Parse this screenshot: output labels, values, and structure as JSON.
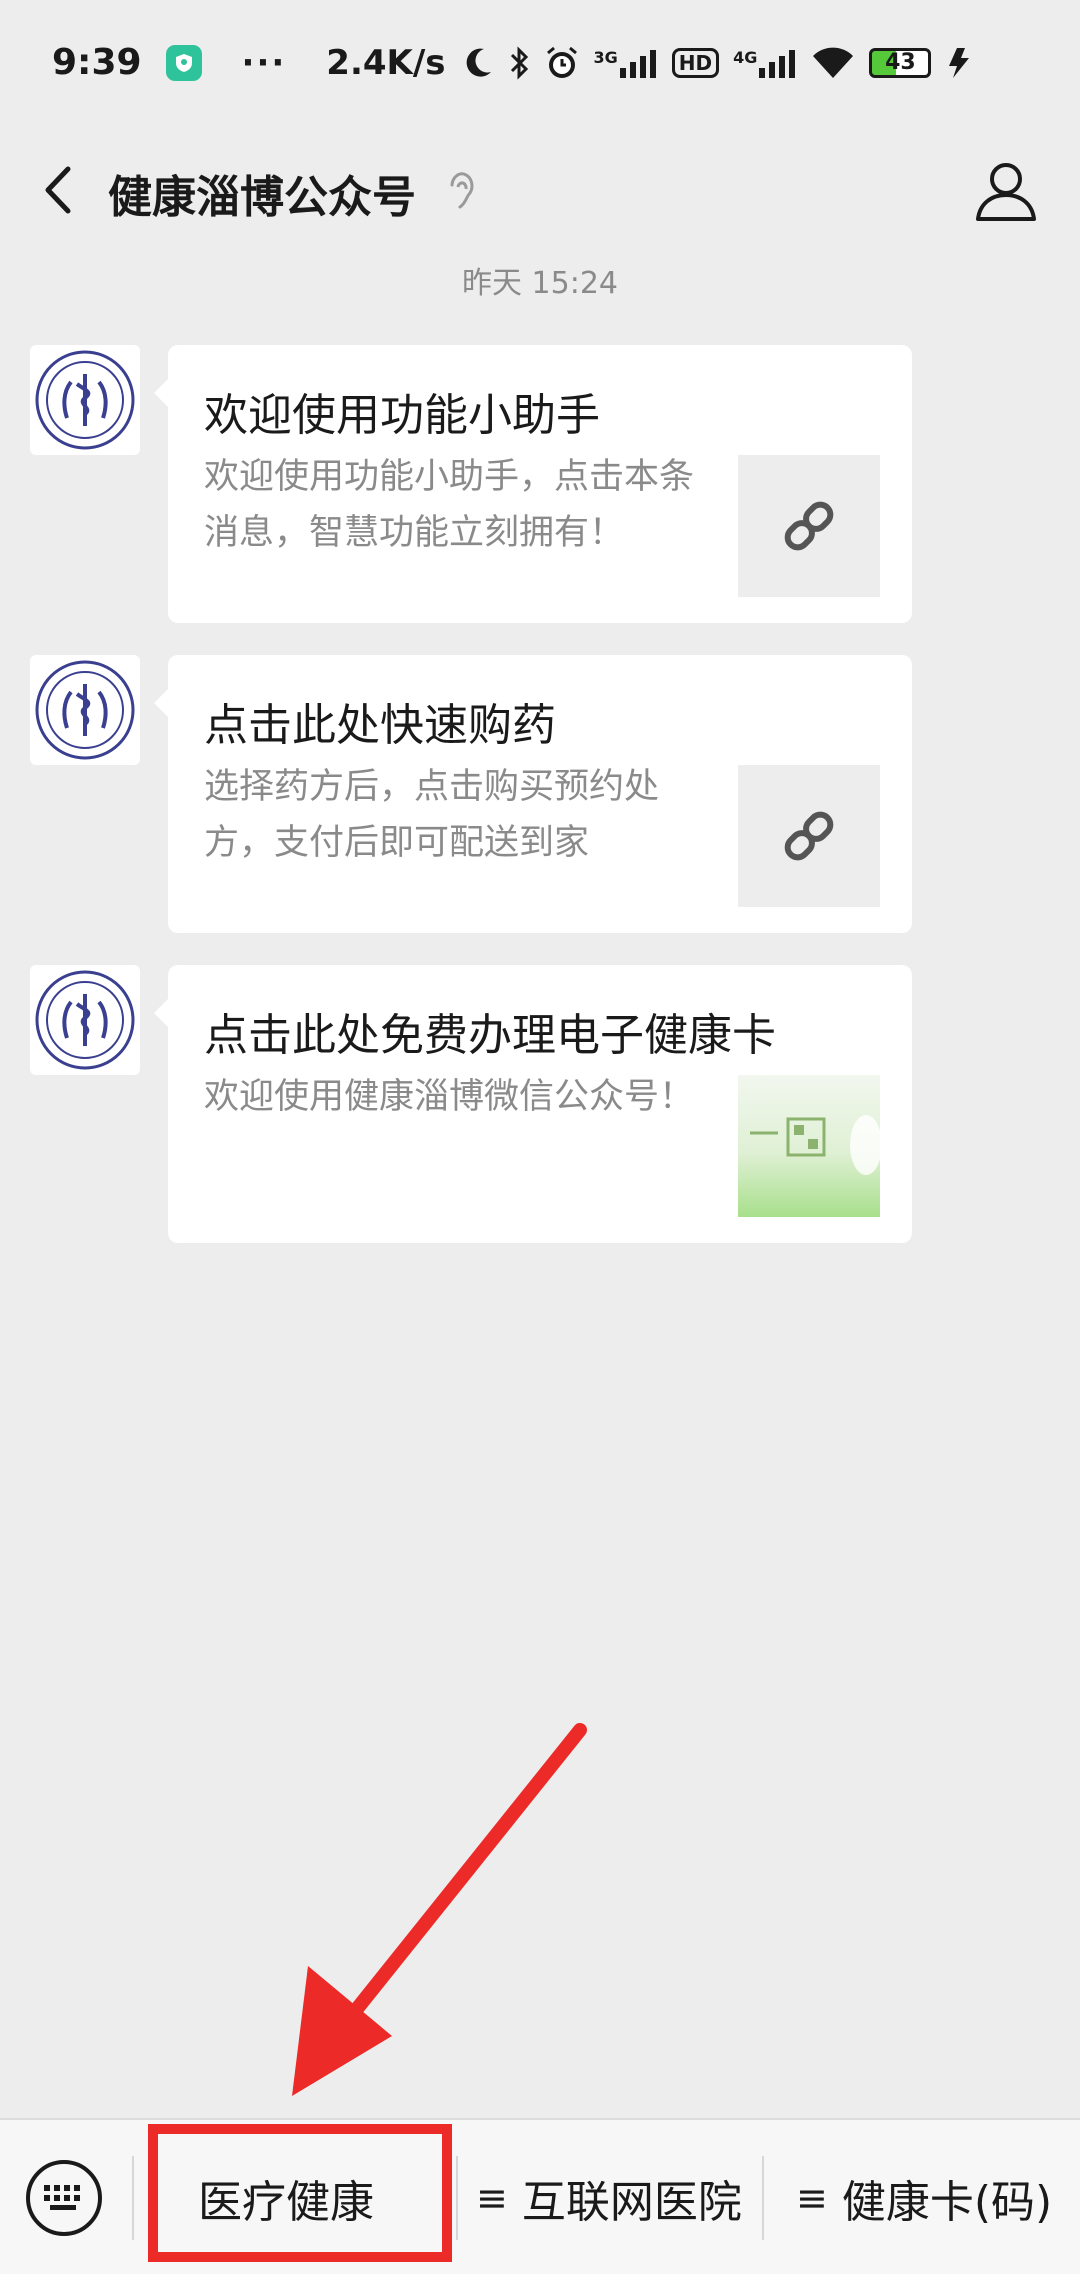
{
  "status_bar": {
    "time": "9:39",
    "dots": "···",
    "speed": "2.4K/s",
    "signal_3g": "3G",
    "hd": "HD",
    "signal_4g": "4G",
    "battery": "43"
  },
  "header": {
    "title": "健康淄博公众号"
  },
  "timestamp": "昨天 15:24",
  "messages": [
    {
      "title": "欢迎使用功能小助手",
      "desc": "欢迎使用功能小助手，点击本条消息，智慧功能立刻拥有！",
      "thumb_icon": "link-icon"
    },
    {
      "title": "点击此处快速购药",
      "desc": "选择药方后，点击购买预约处方，支付后即可配送到家",
      "thumb_icon": "link-icon"
    },
    {
      "title": "点击此处免费办理电子健康卡",
      "desc": "欢迎使用健康淄博微信公众号！",
      "thumb_icon": "health-card-image"
    }
  ],
  "menu": {
    "items": [
      {
        "label": "医疗健康",
        "hamburger": ""
      },
      {
        "label": "互联网医院",
        "hamburger": "≡"
      },
      {
        "label": "健康卡(码)",
        "hamburger": "≡"
      }
    ]
  },
  "colors": {
    "background": "#ededed",
    "annotation": "#ec2a28",
    "battery_fill": "#55c93a",
    "shield": "#2fc39b"
  }
}
